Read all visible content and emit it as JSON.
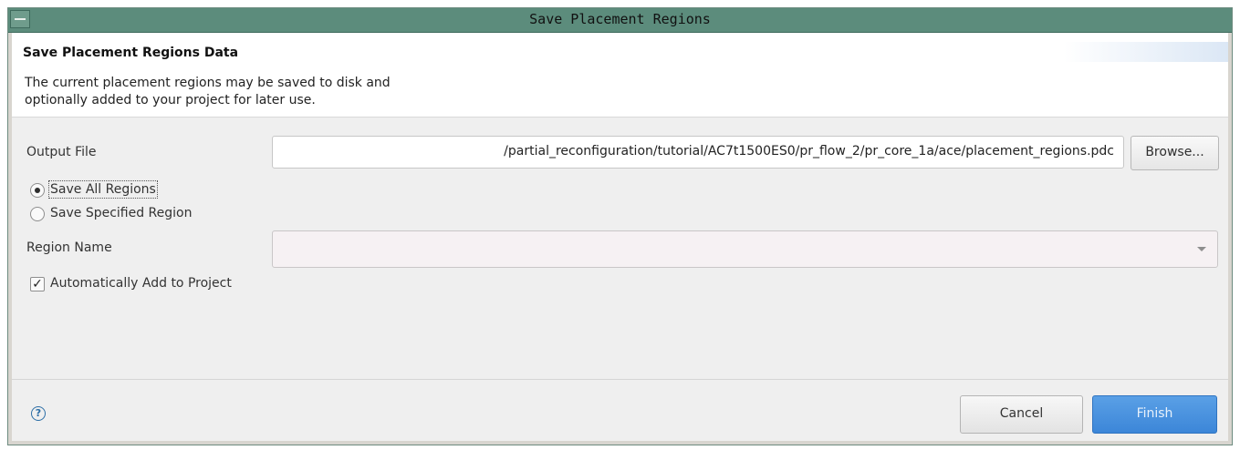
{
  "window": {
    "title": "Save Placement Regions"
  },
  "banner": {
    "title": "Save Placement Regions Data",
    "description_line1": "The current placement regions may be saved to disk and",
    "description_line2": "optionally added to your project for later use."
  },
  "output_file": {
    "label": "Output File",
    "value": "/partial_reconfiguration/tutorial/AC7t1500ES0/pr_flow_2/pr_core_1a/ace/placement_regions.pdc",
    "browse_label": "Browse..."
  },
  "save_mode": {
    "options": [
      {
        "label": "Save All Regions",
        "selected": true
      },
      {
        "label": "Save Specified Region",
        "selected": false
      }
    ]
  },
  "region_name": {
    "label": "Region Name",
    "value": ""
  },
  "auto_add": {
    "label": "Automatically Add to Project",
    "checked": true
  },
  "footer": {
    "cancel_label": "Cancel",
    "finish_label": "Finish",
    "help_glyph": "?"
  },
  "colors": {
    "titlebar": "#5c8c7c",
    "finish_button": "#3c86d8",
    "dialog_bg": "#efefef"
  },
  "icons": {
    "window_menu": "window-menu-icon",
    "help": "help-icon",
    "dropdown": "chevron-down-icon",
    "check": "checkmark-icon"
  }
}
